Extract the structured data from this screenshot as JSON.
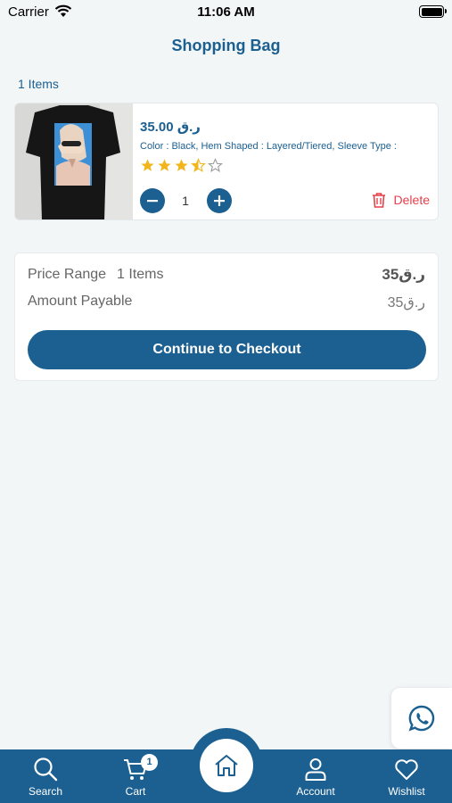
{
  "status_bar": {
    "carrier": "Carrier",
    "time": "11:06 AM"
  },
  "header": {
    "title": "Shopping Bag"
  },
  "cart": {
    "items_count_label": "1 Items",
    "items": [
      {
        "price": "35.00 ر.ق",
        "description": "Color : Black, Hem Shaped : Layered/Tiered, Sleeve Type : ",
        "rating": 3.5,
        "rating_max": 5,
        "quantity": "1",
        "delete_label": "Delete"
      }
    ]
  },
  "summary": {
    "price_range_label": "Price Range",
    "price_range_count": "1 Items",
    "price_range_value": "ر.ق35",
    "amount_payable_label": "Amount Payable",
    "amount_payable_value": "ر.ق35",
    "checkout_label": "Continue to Checkout"
  },
  "bottom_nav": {
    "search_label": "Search",
    "cart_label": "Cart",
    "cart_badge": "1",
    "account_label": "Account",
    "wishlist_label": "Wishlist"
  },
  "colors": {
    "primary": "#1c6091",
    "star": "#f2b51c",
    "delete": "#e63e4a",
    "background": "#f2f6f6"
  },
  "icons": [
    "wifi-icon",
    "battery-icon",
    "minus-icon",
    "plus-icon",
    "trash-icon",
    "whatsapp-icon",
    "search-icon",
    "cart-icon",
    "home-icon",
    "account-icon",
    "heart-icon"
  ]
}
